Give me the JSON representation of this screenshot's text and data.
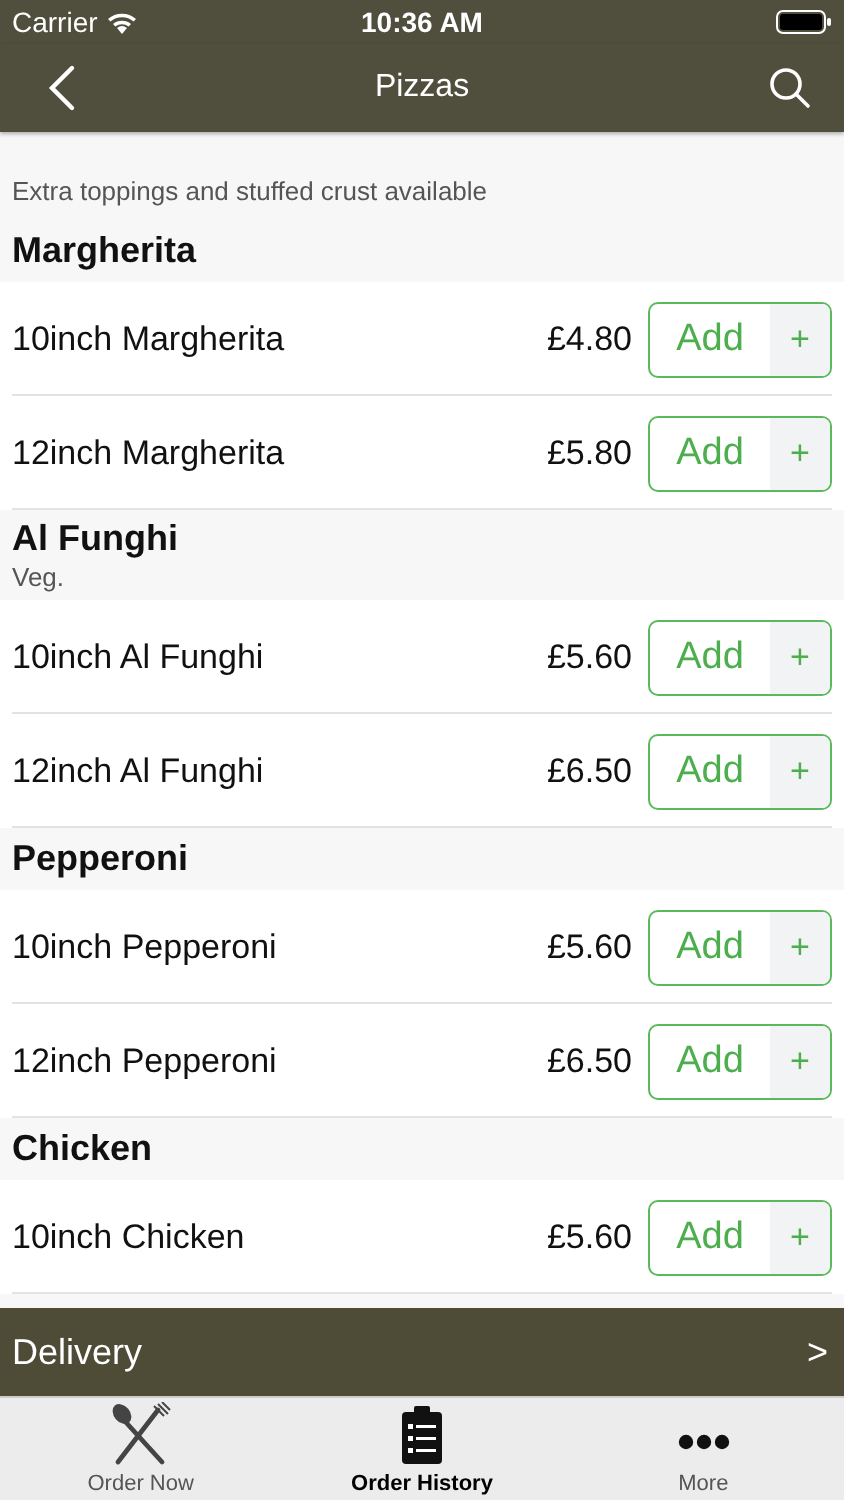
{
  "status_bar": {
    "carrier": "Carrier",
    "time": "10:36 AM"
  },
  "nav": {
    "title": "Pizzas"
  },
  "intro": "Extra toppings and stuffed crust available",
  "sections": [
    {
      "title": "Margherita",
      "items": [
        {
          "name": "10inch Margherita",
          "price": "£4.80",
          "button": "Add",
          "plus": "+"
        },
        {
          "name": "12inch Margherita",
          "price": "£5.80",
          "button": "Add",
          "plus": "+"
        }
      ]
    },
    {
      "title": "Al Funghi",
      "subtitle": "Veg.",
      "items": [
        {
          "name": "10inch Al Funghi",
          "price": "£5.60",
          "button": "Add",
          "plus": "+"
        },
        {
          "name": "12inch Al Funghi",
          "price": "£6.50",
          "button": "Add",
          "plus": "+"
        }
      ]
    },
    {
      "title": "Pepperoni",
      "items": [
        {
          "name": "10inch Pepperoni",
          "price": "£5.60",
          "button": "Add",
          "plus": "+"
        },
        {
          "name": "12inch Pepperoni",
          "price": "£6.50",
          "button": "Add",
          "plus": "+"
        }
      ]
    },
    {
      "title": "Chicken",
      "items": [
        {
          "name": "10inch Chicken",
          "price": "£5.60",
          "button": "Add",
          "plus": "+"
        }
      ]
    }
  ],
  "delivery": {
    "label": "Delivery",
    "arrow": ">"
  },
  "tabs": [
    {
      "label": "Order Now",
      "kind": "cutlery",
      "selected": false
    },
    {
      "label": "Order History",
      "kind": "clipboard",
      "selected": true
    },
    {
      "label": "More",
      "kind": "dots",
      "selected": false
    }
  ]
}
